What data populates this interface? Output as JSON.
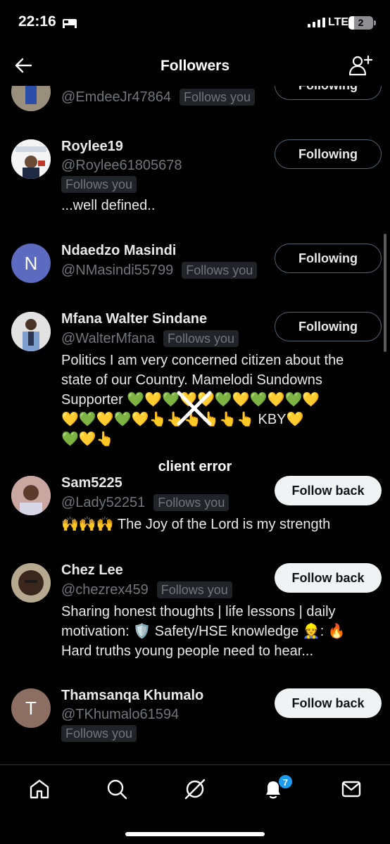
{
  "status_bar": {
    "time": "22:16",
    "network": "LTE",
    "battery": "2"
  },
  "header": {
    "title": "Followers"
  },
  "followers": [
    {
      "name": "",
      "handle": "@EmdeeJr47864",
      "badge": "Follows you",
      "button": "Following",
      "bio": ""
    },
    {
      "name": "Roylee19",
      "handle": "@Roylee61805678",
      "badge": "Follows you",
      "button": "Following",
      "bio": "...well defined.."
    },
    {
      "name": "Ndaedzo Masindi",
      "handle": "@NMasindi55799",
      "badge": "Follows you",
      "button": "Following",
      "bio": "",
      "avatar_letter": "N"
    },
    {
      "name": "Mfana Walter Sindane",
      "handle": "@WalterMfana",
      "badge": "Follows you",
      "button": "Following",
      "bio_lines": [
        "Politics I am very concerned citizen about the",
        "state of our Country. Mamelodi Sundowns",
        "Supporter 💚💛💚💛💛💚💛💚💛💚💛",
        "💛💚💛💚💛👆👆👆👆👆👆 KBY💛",
        "💚💛👆"
      ]
    },
    {
      "name": "Sam5225",
      "handle": "@Lady52251",
      "badge": "Follows you",
      "button": "Follow back",
      "bio": "🙌🙌🙌 The Joy of the Lord is my strength"
    },
    {
      "name": "Chez Lee",
      "handle": "@chezrex459",
      "badge": "Follows you",
      "button": "Follow back",
      "bio_lines": [
        "Sharing honest thoughts | life lessons | daily",
        "motivation: 🛡️ Safety/HSE knowledge 👷: 🔥",
        "Hard truths young people need to hear..."
      ]
    },
    {
      "name": "Thamsanqa Khumalo",
      "handle": "@TKhumalo61594",
      "badge": "Follows you",
      "button": "Follow back",
      "bio": "",
      "avatar_letter": "T"
    }
  ],
  "overlay": {
    "error": "client error"
  },
  "nav": {
    "notification_count": "7"
  },
  "colors": {
    "accent": "#1d9bf0",
    "avatar_n": "#5c6bc0",
    "avatar_t": "#8d6e63"
  }
}
